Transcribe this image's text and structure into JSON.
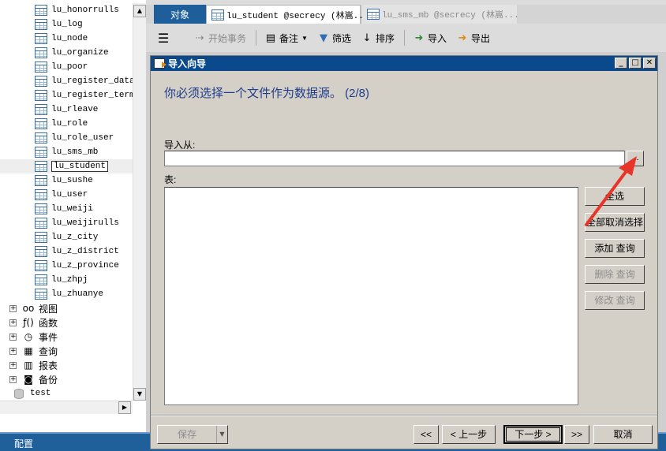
{
  "tree": {
    "tables": [
      "lu_honorrulls",
      "lu_log",
      "lu_node",
      "lu_organize",
      "lu_poor",
      "lu_register_data",
      "lu_register_terms",
      "lu_rleave",
      "lu_role",
      "lu_role_user",
      "lu_sms_mb",
      "lu_student",
      "lu_sushe",
      "lu_user",
      "lu_weiji",
      "lu_weijirulls",
      "lu_z_city",
      "lu_z_district",
      "lu_z_province",
      "lu_zhpj",
      "lu_zhuanye"
    ],
    "selected_table": "lu_student",
    "groups": [
      {
        "label": "视图",
        "icon": "glasses-icon"
      },
      {
        "label": "函数",
        "icon": "function-icon"
      },
      {
        "label": "事件",
        "icon": "clock-icon"
      },
      {
        "label": "查询",
        "icon": "query-icon"
      },
      {
        "label": "报表",
        "icon": "report-icon"
      },
      {
        "label": "备份",
        "icon": "backup-icon"
      }
    ],
    "database": "test"
  },
  "statusbar": {
    "config_label": "配置"
  },
  "tabs": {
    "objects": "对象",
    "active": "lu_student @secrecy (林嵩...",
    "inactive": "lu_sms_mb @secrecy (林嵩..."
  },
  "toolbar": {
    "begin_transaction": "开始事务",
    "memo": "备注",
    "filter": "筛选",
    "sort": "排序",
    "import": "导入",
    "export": "导出"
  },
  "dialog": {
    "title": "导入向导",
    "heading": "你必须选择一个文件作为数据源。 (2/8)",
    "import_from_label": "导入从:",
    "import_from_value": "",
    "browse_label": "...",
    "table_label": "表:",
    "buttons": {
      "select_all": "全选",
      "deselect_all": "全部取消选择",
      "add_query": "添加 查询",
      "delete_query": "删除 查询",
      "modify_query": "修改 查询",
      "save": "保存",
      "first": "<<",
      "prev": "< 上一步",
      "next": "下一步 >",
      "last": ">>",
      "cancel": "取消"
    }
  },
  "colors": {
    "dialog_title_bg": "#0a4a8c",
    "heading_text": "#1f3d8a",
    "status_bar": "#1f5f9a",
    "annotation_arrow": "#e8352a"
  }
}
